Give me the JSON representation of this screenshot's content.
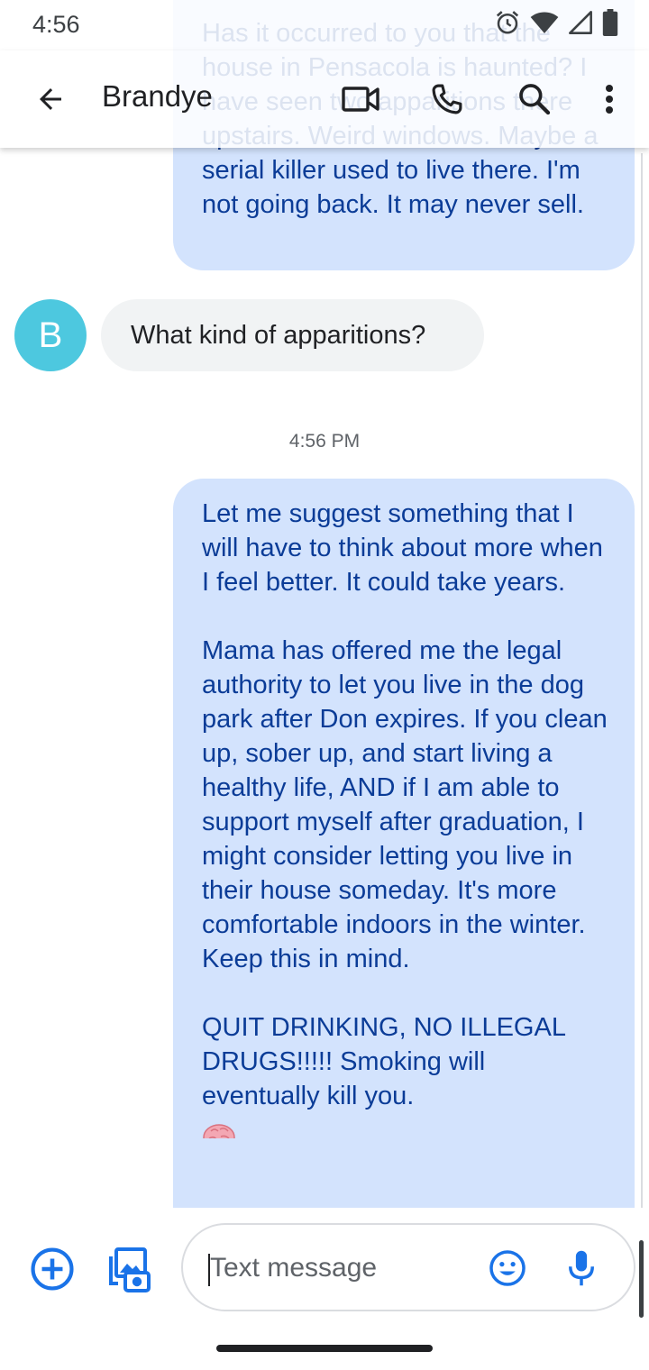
{
  "status_bar": {
    "time": "4:56",
    "icons": [
      "alarm-icon",
      "wifi-icon",
      "cell-signal-icon",
      "battery-icon"
    ]
  },
  "app_bar": {
    "contact_name": "Brandye",
    "icons": [
      "back-arrow-icon",
      "video-call-icon",
      "phone-icon",
      "search-icon",
      "more-vert-icon"
    ]
  },
  "messages": {
    "outgoing_1": "Has it occurred to you that the house in Pensacola is haunted? I have seen two apparitions there upstairs. Weird windows. Maybe a serial killer used to live there. I'm not going back. It may never sell.",
    "incoming_1": {
      "avatar_letter": "B",
      "text": "What kind of apparitions?"
    },
    "timestamp": "4:56 PM",
    "outgoing_2": {
      "paragraph_1": "Let me suggest something that I will have to think about more when I feel better. It could take years.",
      "paragraph_2": "Mama has offered me the legal authority to let you live in the dog park after Don expires. If you clean up, sober up, and start living a healthy life, AND if I am able to support myself after graduation, I might consider letting you live in their house someday. It's more comfortable indoors in the winter. Keep this in mind.",
      "paragraph_3": "QUIT DRINKING, NO ILLEGAL DRUGS!!!!! Smoking will eventually kill you.",
      "emoji": "brain-emoji"
    }
  },
  "compose": {
    "placeholder": "Text message",
    "value": "",
    "icons": [
      "add-icon",
      "gallery-camera-icon",
      "emoji-icon",
      "mic-icon"
    ]
  },
  "colors": {
    "outgoing_bubble": "#d3e3fd",
    "outgoing_text": "#0b3c97",
    "incoming_bubble": "#f1f3f4",
    "avatar": "#4dc8df",
    "accent": "#1a73e8"
  }
}
